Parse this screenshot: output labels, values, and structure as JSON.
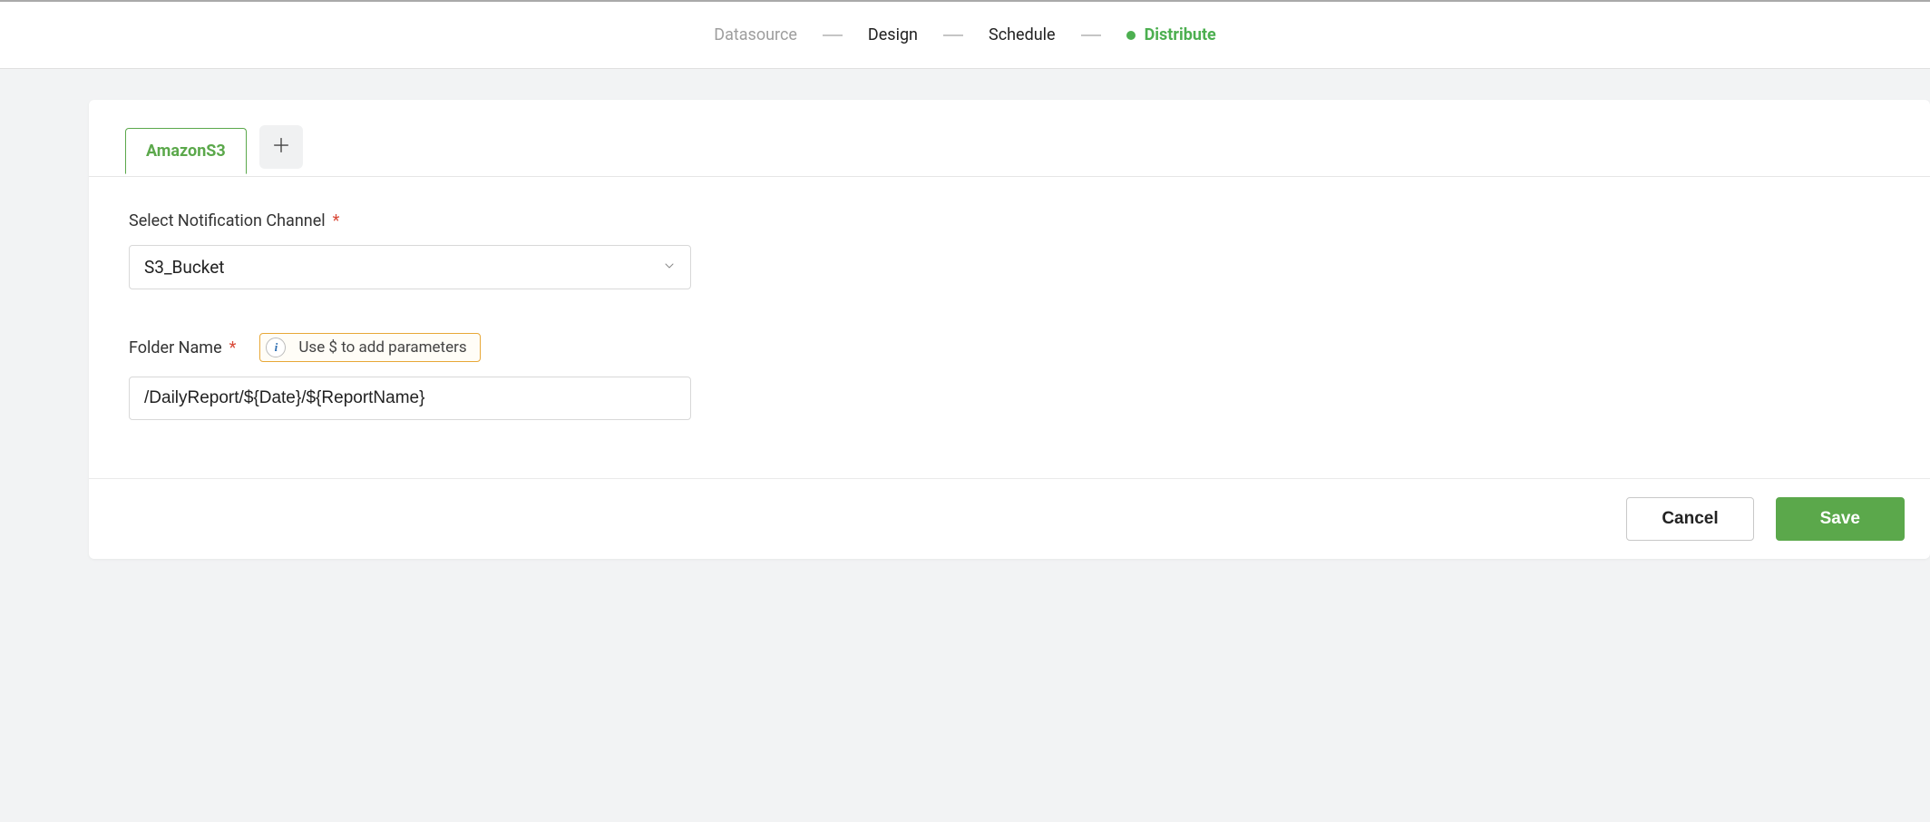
{
  "breadcrumb": {
    "items": [
      {
        "label": "Datasource",
        "state": "inactive"
      },
      {
        "label": "Design",
        "state": "normal"
      },
      {
        "label": "Schedule",
        "state": "normal"
      },
      {
        "label": "Distribute",
        "state": "active"
      }
    ]
  },
  "tabs": {
    "active_label": "AmazonS3"
  },
  "form": {
    "channel": {
      "label": "Select Notification Channel",
      "value": "S3_Bucket"
    },
    "folder": {
      "label": "Folder Name",
      "hint": "Use $ to add parameters",
      "value": "/DailyReport/${Date}/${ReportName}"
    }
  },
  "footer": {
    "cancel_label": "Cancel",
    "save_label": "Save"
  }
}
